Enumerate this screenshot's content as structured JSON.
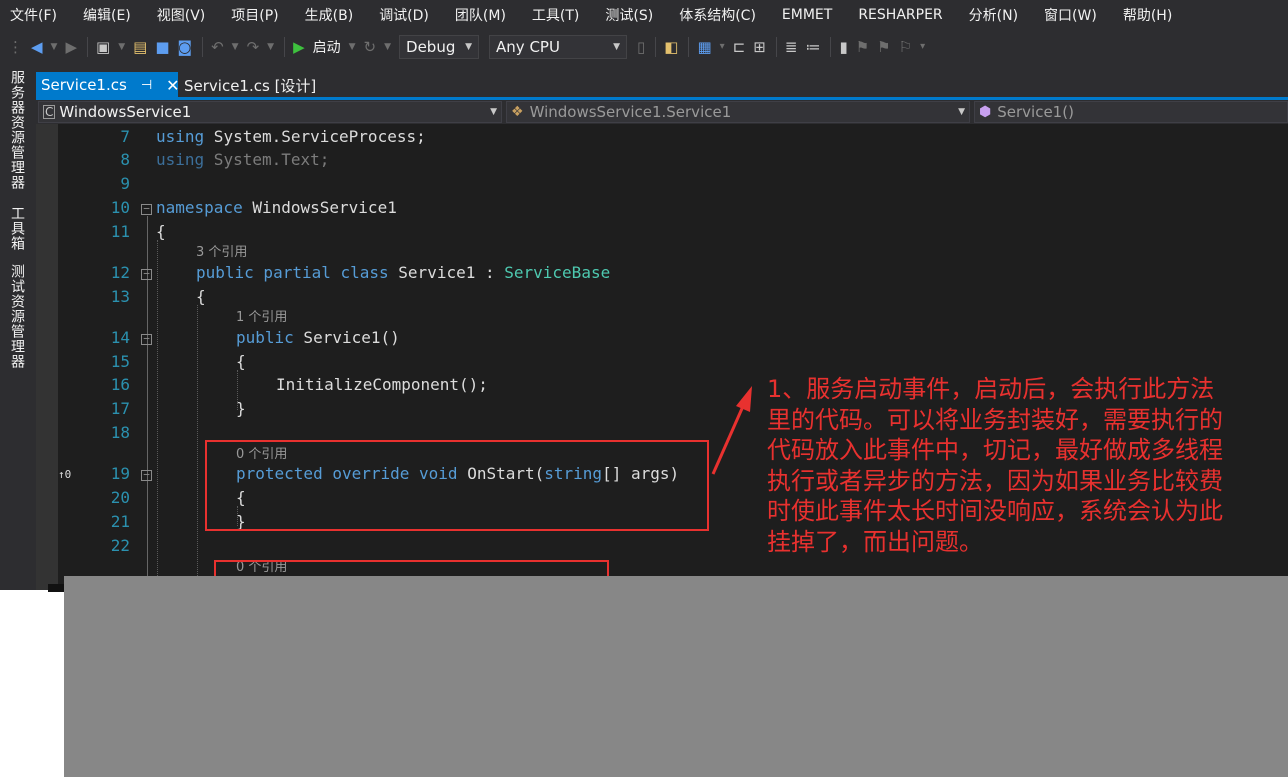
{
  "menu": [
    "文件(F)",
    "编辑(E)",
    "视图(V)",
    "项目(P)",
    "生成(B)",
    "调试(D)",
    "团队(M)",
    "工具(T)",
    "测试(S)",
    "体系结构(C)",
    "EMMET",
    "RESHARPER",
    "分析(N)",
    "窗口(W)",
    "帮助(H)"
  ],
  "toolbar": {
    "start_label": "启动",
    "config_value": "Debug",
    "platform_value": "Any CPU"
  },
  "side_panels": [
    "服务器资源管理器",
    "工具箱",
    "测试资源管理器"
  ],
  "tabs": [
    {
      "label": "Service1.cs",
      "active": true
    },
    {
      "label": "Service1.cs [设计]",
      "active": false
    }
  ],
  "nav": {
    "project": "WindowsService1",
    "type": "WindowsService1.Service1",
    "member": "Service1()"
  },
  "code": {
    "line_numbers": [
      "7",
      "8",
      "9",
      "10",
      "11",
      "12",
      "13",
      "14",
      "15",
      "16",
      "17",
      "18",
      "19",
      "20",
      "21",
      "22"
    ],
    "line7": {
      "kw": "using",
      "rest": " System.ServiceProcess;"
    },
    "line8": {
      "kw": "using",
      "rest": " System.Text;"
    },
    "line10": {
      "kw": "namespace",
      "rest": " WindowsService1"
    },
    "line11": "{",
    "lens_class": "3 个引用",
    "line12": {
      "kw": "public partial class",
      "name": " Service1 : ",
      "base": "ServiceBase"
    },
    "line13": "{",
    "lens_ctor": "1 个引用",
    "line14": {
      "kw": "public",
      "rest": " Service1()"
    },
    "line15": "{",
    "line16": "InitializeComponent();",
    "line17": "}",
    "lens_onstart": "0 个引用",
    "line19": {
      "kw": "protected override void",
      "name": " OnStart(",
      "type": "string",
      "rest": "[] args)"
    },
    "line20": "{",
    "line21": "}",
    "lens_next": "0 个引用",
    "override_marker": "↑0"
  },
  "annotation": [
    "1、服务启动事件，启动后，会执行此方法",
    "里的代码。可以将业务封装好，需要执行的",
    "代码放入此事件中，切记，最好做成多线程",
    "执行或者异步的方法，因为如果业务比较费",
    "时使此事件太长时间没响应，系统会认为此",
    "挂掉了，而出问题。"
  ],
  "colors": {
    "ide_background": "#2d2d30",
    "editor_background": "#1e1e1e",
    "accent": "#007acc",
    "keyword": "#569cd6",
    "type": "#4ec9b0",
    "line_number": "#2b91af",
    "annotation_red": "#e8312f",
    "grey_overlay": "#878787"
  },
  "icons": [
    "back-icon",
    "forward-icon",
    "new-project-icon",
    "open-icon",
    "save-icon",
    "save-all-icon",
    "undo-icon",
    "redo-icon",
    "start-icon",
    "refresh-icon",
    "pin-icon",
    "close-icon",
    "bookmark-icon"
  ]
}
